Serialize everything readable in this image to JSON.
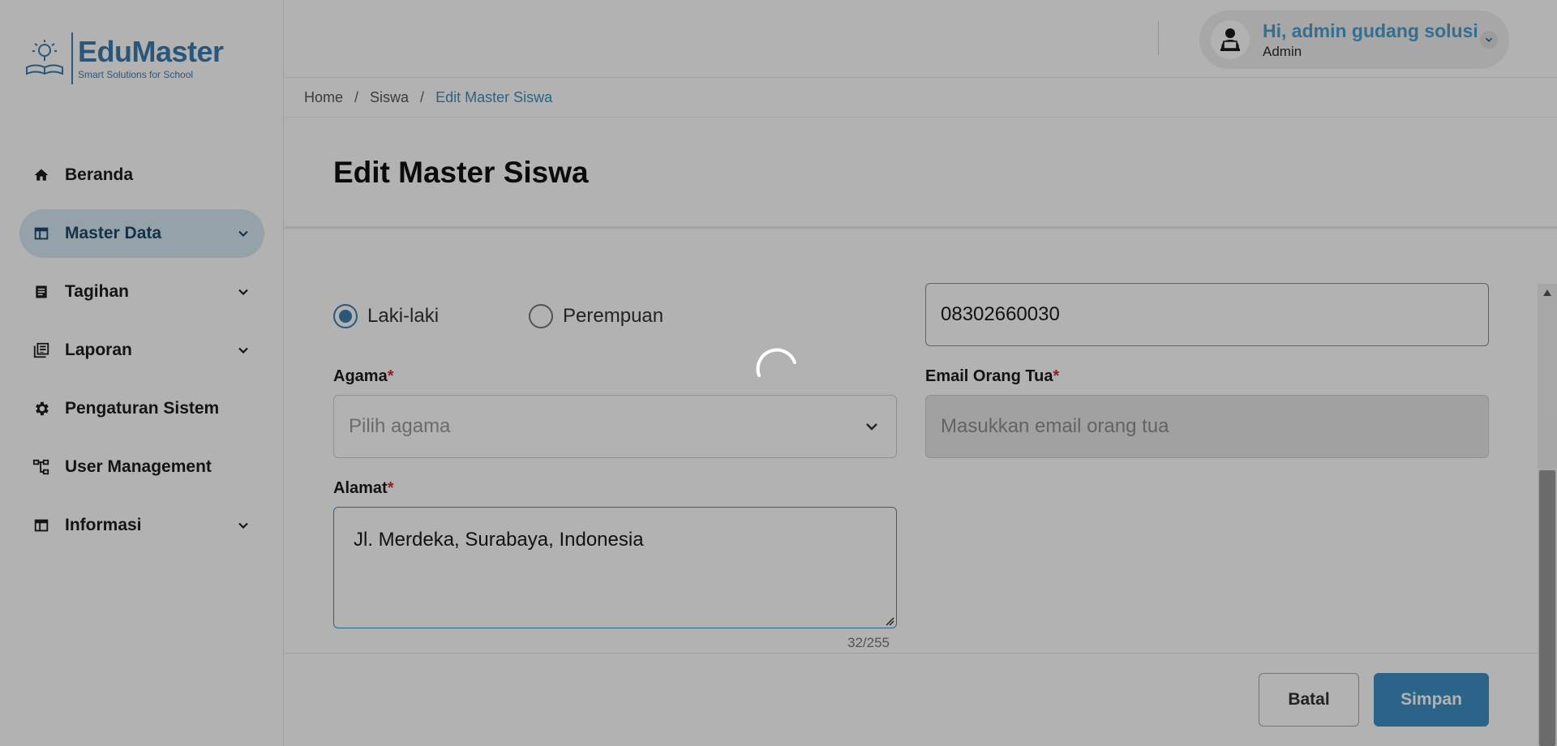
{
  "brand": {
    "title": "EduMaster",
    "subtitle": "Smart Solutions for School"
  },
  "sidebar": {
    "items": [
      {
        "label": "Beranda",
        "icon": "home-icon",
        "has_submenu": false,
        "active": false
      },
      {
        "label": "Master Data",
        "icon": "table-icon",
        "has_submenu": true,
        "active": true
      },
      {
        "label": "Tagihan",
        "icon": "document-list-icon",
        "has_submenu": true,
        "active": false
      },
      {
        "label": "Laporan",
        "icon": "report-library-icon",
        "has_submenu": true,
        "active": false
      },
      {
        "label": "Pengaturan Sistem",
        "icon": "gear-icon",
        "has_submenu": false,
        "active": false
      },
      {
        "label": "User Management",
        "icon": "tree-structure-icon",
        "has_submenu": false,
        "active": false
      },
      {
        "label": "Informasi",
        "icon": "table-icon",
        "has_submenu": true,
        "active": false
      }
    ]
  },
  "header": {
    "greeting": "Hi, admin gudang solusi",
    "role": "Admin"
  },
  "breadcrumb": {
    "home": "Home",
    "parent": "Siswa",
    "current": "Edit Master Siswa",
    "separator": "/"
  },
  "page": {
    "title": "Edit Master Siswa"
  },
  "form": {
    "gender": {
      "male": "Laki-laki",
      "female": "Perempuan",
      "selected": "Laki-laki"
    },
    "phone": {
      "value": "08302660030"
    },
    "religion": {
      "label": "Agama",
      "placeholder": "Pilih agama"
    },
    "parent_email": {
      "label": "Email Orang Tua",
      "placeholder": "Masukkan email orang tua"
    },
    "address": {
      "label": "Alamat",
      "value": "Jl. Merdeka, Surabaya, Indonesia",
      "counter": "32/255"
    },
    "required_mark": "*"
  },
  "actions": {
    "cancel": "Batal",
    "save": "Simpan"
  },
  "colors": {
    "primary": "#3f8fc5",
    "brand": "#3d7cae",
    "greeting": "#4b9fd0",
    "active_nav_bg": "#d7e8f2",
    "required": "#d32f2f"
  },
  "state": {
    "loading": true
  }
}
